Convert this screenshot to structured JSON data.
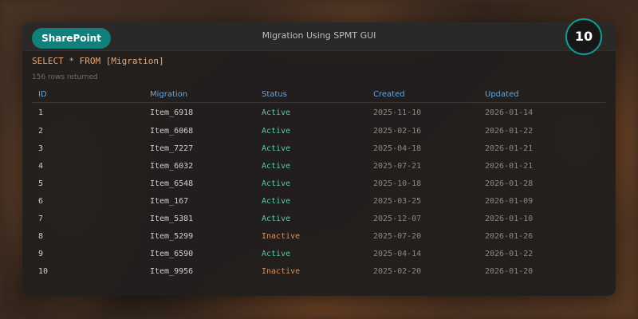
{
  "app": {
    "button_label": "SharePoint",
    "title": "Migration Using SPMT GUI",
    "counter": "10"
  },
  "query": {
    "sql": "SELECT * FROM [Migration]",
    "rows_returned": "156 rows returned"
  },
  "table": {
    "columns": [
      "ID",
      "Migration",
      "Status",
      "Created",
      "Updated"
    ],
    "rows": [
      {
        "id": "1",
        "migration": "Item_6918",
        "status": "Active",
        "created": "2025-11-10",
        "updated": "2026-01-14"
      },
      {
        "id": "2",
        "migration": "Item_6068",
        "status": "Active",
        "created": "2025-02-16",
        "updated": "2026-01-22"
      },
      {
        "id": "3",
        "migration": "Item_7227",
        "status": "Active",
        "created": "2025-04-18",
        "updated": "2026-01-21"
      },
      {
        "id": "4",
        "migration": "Item_6032",
        "status": "Active",
        "created": "2025-07-21",
        "updated": "2026-01-21"
      },
      {
        "id": "5",
        "migration": "Item_6548",
        "status": "Active",
        "created": "2025-10-18",
        "updated": "2026-01-28"
      },
      {
        "id": "6",
        "migration": "Item_167",
        "status": "Active",
        "created": "2025-03-25",
        "updated": "2026-01-09"
      },
      {
        "id": "7",
        "migration": "Item_5381",
        "status": "Active",
        "created": "2025-12-07",
        "updated": "2026-01-10"
      },
      {
        "id": "8",
        "migration": "Item_5299",
        "status": "Inactive",
        "created": "2025-07-20",
        "updated": "2026-01-26"
      },
      {
        "id": "9",
        "migration": "Item_6590",
        "status": "Active",
        "created": "2025-04-14",
        "updated": "2026-01-22"
      },
      {
        "id": "10",
        "migration": "Item_9956",
        "status": "Inactive",
        "created": "2025-02-20",
        "updated": "2026-01-20"
      }
    ]
  },
  "colors": {
    "accent": "#137f7a",
    "header_text": "#6aa5dd",
    "query_text": "#e8a878",
    "status_active": "#5cc9b0",
    "status_inactive": "#d9905f"
  }
}
